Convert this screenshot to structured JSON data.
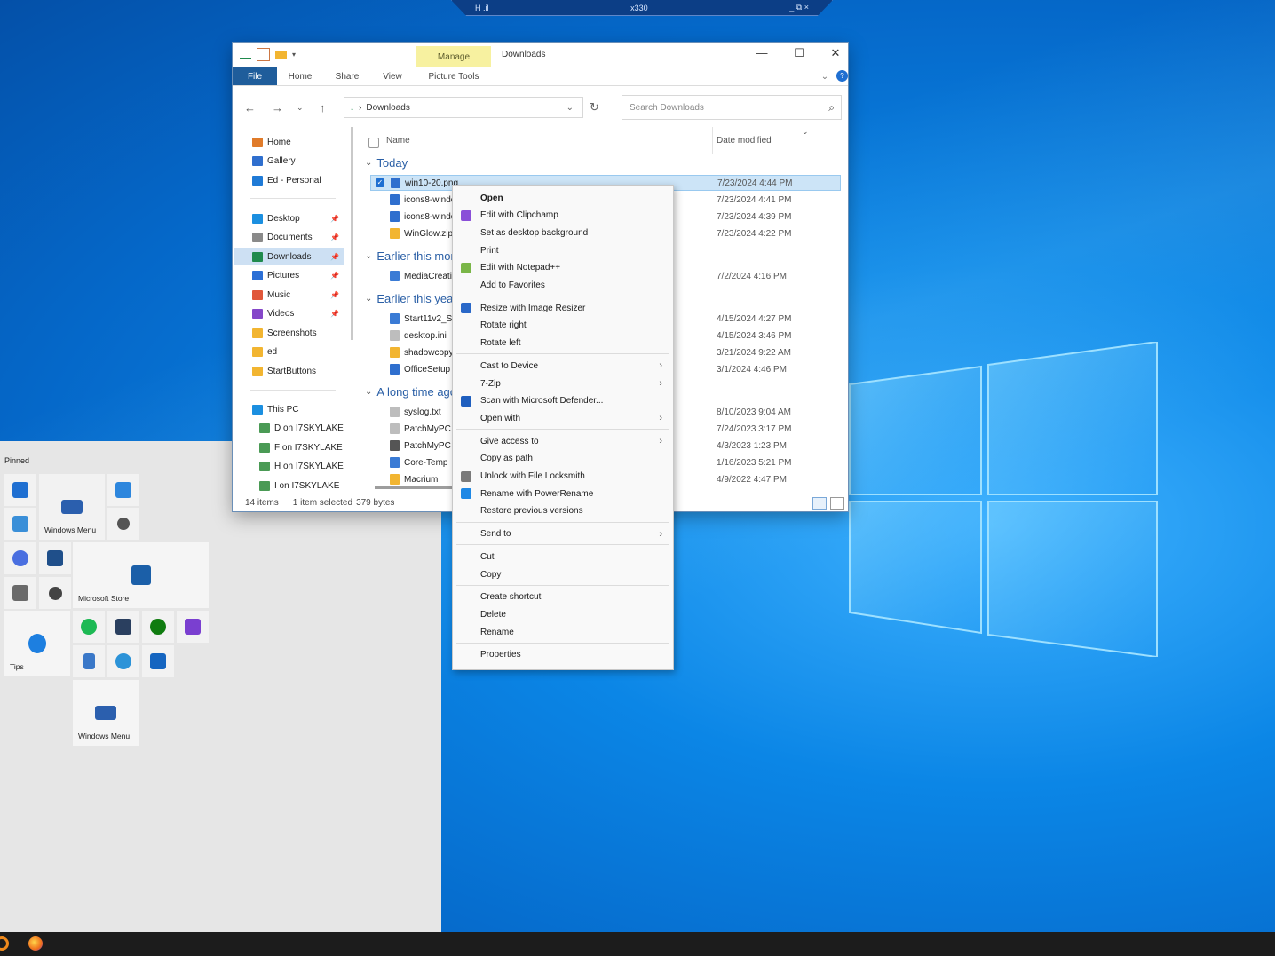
{
  "remote_toolbar": {
    "left_label": "H .il",
    "center_label": "x330",
    "controls": "_ ⧉ ×"
  },
  "explorer": {
    "title": "Downloads",
    "manage_tab": "Manage",
    "ribbon_tabs": [
      "File",
      "Home",
      "Share",
      "View",
      "Picture Tools"
    ],
    "address": "Downloads",
    "search_placeholder": "Search Downloads",
    "nav": {
      "quick": [
        {
          "label": "Home",
          "color": "#e07b2a"
        },
        {
          "label": "Gallery",
          "color": "#2f6fce"
        },
        {
          "label": "Ed - Personal",
          "color": "#1f7ad6"
        }
      ],
      "pinned": [
        {
          "label": "Desktop",
          "color": "#1b8fe0",
          "pin": true
        },
        {
          "label": "Documents",
          "color": "#8a8a8a",
          "pin": true
        },
        {
          "label": "Downloads",
          "color": "#1f8a4d",
          "pin": true,
          "selected": true
        },
        {
          "label": "Pictures",
          "color": "#2b6fd6",
          "pin": true
        },
        {
          "label": "Music",
          "color": "#e0573a",
          "pin": true
        },
        {
          "label": "Videos",
          "color": "#8547c9",
          "pin": true
        },
        {
          "label": "Screenshots",
          "color": "#f2b531"
        },
        {
          "label": "ed",
          "color": "#f2b531"
        },
        {
          "label": "StartButtons",
          "color": "#f2b531"
        }
      ],
      "pc": [
        {
          "label": "This PC",
          "color": "#1b8fe0"
        },
        {
          "label": "D on I7SKYLAKE",
          "color": "#4a9a55"
        },
        {
          "label": "F on I7SKYLAKE",
          "color": "#4a9a55"
        },
        {
          "label": "H on I7SKYLAKE",
          "color": "#4a9a55"
        },
        {
          "label": "I on I7SKYLAKE",
          "color": "#4a9a55"
        }
      ]
    },
    "columns": {
      "name": "Name",
      "date": "Date modified"
    },
    "groups": [
      {
        "label": "Today",
        "files": [
          {
            "name": "win10-20.png",
            "date": "7/23/2024 4:44 PM",
            "selected": true,
            "color": "#2f6fce"
          },
          {
            "name": "icons8-windows",
            "date": "7/23/2024 4:41 PM",
            "color": "#2f6fce"
          },
          {
            "name": "icons8-windows",
            "date": "7/23/2024 4:39 PM",
            "color": "#2f6fce"
          },
          {
            "name": "WinGlow.zip",
            "date": "7/23/2024 4:22 PM",
            "color": "#f2b531"
          }
        ]
      },
      {
        "label": "Earlier this month",
        "files": [
          {
            "name": "MediaCreationTool",
            "date": "7/2/2024 4:16 PM",
            "color": "#3a7bd5"
          }
        ]
      },
      {
        "label": "Earlier this year",
        "files": [
          {
            "name": "Start11v2_Setup",
            "date": "4/15/2024 4:27 PM",
            "color": "#3a7bd5"
          },
          {
            "name": "desktop.ini",
            "date": "4/15/2024 3:46 PM",
            "color": "#bdbdbd"
          },
          {
            "name": "shadowcopy",
            "date": "3/21/2024 9:22 AM",
            "color": "#f2b531"
          },
          {
            "name": "OfficeSetup",
            "date": "3/1/2024 4:46 PM",
            "color": "#2f6fce"
          }
        ]
      },
      {
        "label": "A long time ago",
        "files": [
          {
            "name": "syslog.txt",
            "date": "8/10/2023 9:04 AM",
            "color": "#bdbdbd"
          },
          {
            "name": "PatchMyPC",
            "date": "7/24/2023 3:17 PM",
            "color": "#bdbdbd"
          },
          {
            "name": "PatchMyPC",
            "date": "4/3/2023 1:23 PM",
            "color": "#555555"
          },
          {
            "name": "Core-Temp",
            "date": "1/16/2023 5:21 PM",
            "color": "#3a7bd5"
          },
          {
            "name": "Macrium",
            "date": "4/9/2022 4:47 PM",
            "color": "#f2b531"
          }
        ]
      }
    ],
    "status": {
      "count": "14 items",
      "selected": "1 item selected",
      "size": "379 bytes"
    }
  },
  "context_menu": [
    {
      "label": "Open",
      "bold": true
    },
    {
      "label": "Edit with Clipchamp",
      "icon": "#8a4fd8"
    },
    {
      "label": "Set as desktop background"
    },
    {
      "label": "Print"
    },
    {
      "label": "Edit with Notepad++",
      "icon": "#7ab648"
    },
    {
      "label": "Add to Favorites"
    },
    {
      "sep": true
    },
    {
      "label": "Resize with Image Resizer",
      "icon": "#2a68c8"
    },
    {
      "label": "Rotate right"
    },
    {
      "label": "Rotate left"
    },
    {
      "sep": true
    },
    {
      "label": "Cast to Device",
      "arrow": true
    },
    {
      "label": "7-Zip",
      "arrow": true
    },
    {
      "label": "Scan with Microsoft Defender...",
      "icon": "#1f5fbf"
    },
    {
      "label": "Open with",
      "arrow": true
    },
    {
      "sep": true
    },
    {
      "label": "Give access to",
      "arrow": true
    },
    {
      "label": "Copy as path"
    },
    {
      "label": "Unlock with File Locksmith",
      "icon": "#7a7a7a"
    },
    {
      "label": "Rename with PowerRename",
      "icon": "#1e88e5"
    },
    {
      "label": "Restore previous versions"
    },
    {
      "sep": true
    },
    {
      "label": "Send to",
      "arrow": true
    },
    {
      "sep": true
    },
    {
      "label": "Cut"
    },
    {
      "label": "Copy"
    },
    {
      "sep": true
    },
    {
      "label": "Create shortcut"
    },
    {
      "label": "Delete"
    },
    {
      "label": "Rename"
    },
    {
      "sep": true
    },
    {
      "label": "Properties"
    }
  ],
  "start_menu": {
    "pinned_label": "Pinned",
    "tiles": {
      "windows_menu": "Windows Menu",
      "microsoft_store": "Microsoft Store",
      "tips": "Tips",
      "windows_menu_2": "Windows Menu"
    }
  },
  "colors": {
    "accent": "#0a78d7",
    "file_tab": "#1f5d9b",
    "selection": "#cce4f7"
  }
}
